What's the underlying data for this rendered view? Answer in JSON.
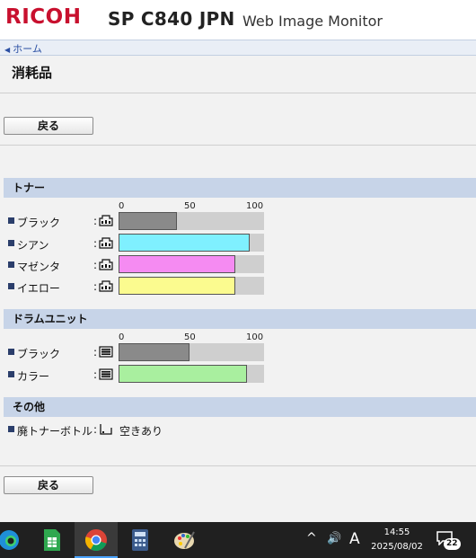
{
  "header": {
    "logo": "RICOH",
    "model": "SP C840 JPN",
    "product": "Web Image Monitor"
  },
  "breadcrumb": {
    "home": "ホーム"
  },
  "page": {
    "title": "消耗品"
  },
  "buttons": {
    "back_top": "戻る",
    "back_bottom": "戻る"
  },
  "scale": {
    "min": "0",
    "mid": "50",
    "max": "100"
  },
  "toner": {
    "heading": "トナー",
    "items": [
      {
        "label": "ブラック",
        "level": 40,
        "color": "#8a8a8a"
      },
      {
        "label": "シアン",
        "level": 90,
        "color": "#7ff0ff"
      },
      {
        "label": "マゼンタ",
        "level": 80,
        "color": "#f58bf2"
      },
      {
        "label": "イエロー",
        "level": 80,
        "color": "#fbfb8f"
      }
    ]
  },
  "drum": {
    "heading": "ドラムユニット",
    "items": [
      {
        "label": "ブラック",
        "level": 49,
        "color": "#8a8a8a"
      },
      {
        "label": "カラー",
        "level": 88,
        "color": "#a9ef9f"
      }
    ]
  },
  "other": {
    "heading": "その他",
    "waste_label": "廃トナーボトル",
    "waste_status": "空きあり"
  },
  "taskbar": {
    "time": "14:55",
    "date": "2025/08/02",
    "ime": "A",
    "notifications": "22"
  },
  "colors": {
    "logo": "#c8102e",
    "section_bg": "#c7d4e8"
  }
}
